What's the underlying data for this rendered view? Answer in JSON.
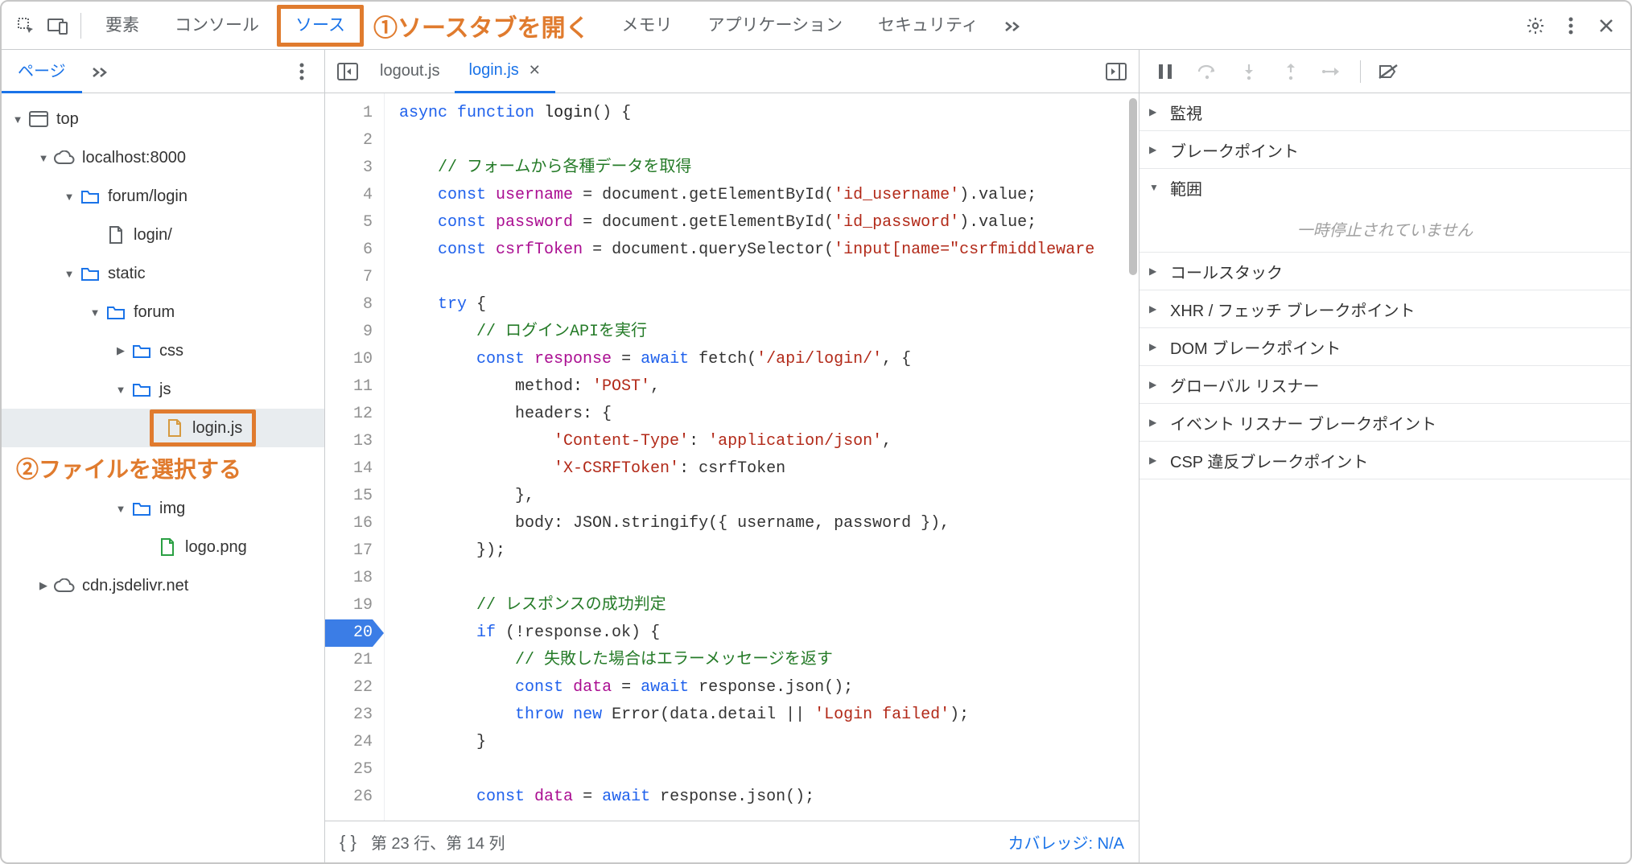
{
  "toolbar": {
    "tabs": {
      "elements": "要素",
      "console": "コンソール",
      "sources": "ソース",
      "memory": "メモリ",
      "application": "アプリケーション",
      "security": "セキュリティ"
    },
    "annotation1": "①ソースタブを開く"
  },
  "leftPanel": {
    "subTab": "ページ",
    "tree": {
      "top": "top",
      "host": "localhost:8000",
      "forumLogin": "forum/login",
      "loginPath": "login/",
      "static": "static",
      "forum": "forum",
      "css": "css",
      "js": "js",
      "loginJs": "login.js",
      "img": "img",
      "logoPng": "logo.png",
      "cdn": "cdn.jsdelivr.net"
    },
    "annotation2": "②ファイルを選択する"
  },
  "centerPanel": {
    "tabs": {
      "logout": "logout.js",
      "login": "login.js"
    },
    "status": {
      "cursor": "第 23 行、第 14 列",
      "coverage": "カバレッジ: N/A"
    },
    "code": {
      "l1": {
        "a": "async",
        "b": "function",
        "c": "login",
        "d": "() {"
      },
      "l3": "// フォームから各種データを取得",
      "l4": {
        "a": "const",
        "b": "username",
        "c": " = document.getElementById(",
        "d": "'id_username'",
        "e": ").value;"
      },
      "l5": {
        "a": "const",
        "b": "password",
        "c": " = document.getElementById(",
        "d": "'id_password'",
        "e": ").value;"
      },
      "l6": {
        "a": "const",
        "b": "csrfToken",
        "c": " = document.querySelector(",
        "d": "'input[name=\"csrfmiddleware",
        "e": ""
      },
      "l8": {
        "a": "try",
        "b": " {"
      },
      "l9": "// ログインAPIを実行",
      "l10": {
        "a": "const",
        "b": "response",
        "c": " = ",
        "d": "await",
        "e": " fetch(",
        "f": "'/api/login/'",
        "g": ", {"
      },
      "l11": {
        "a": "method: ",
        "b": "'POST'",
        "c": ","
      },
      "l12": "headers: {",
      "l13": {
        "a": "'Content-Type'",
        "b": ": ",
        "c": "'application/json'",
        "d": ","
      },
      "l14": {
        "a": "'X-CSRFToken'",
        "b": ": csrfToken"
      },
      "l15": "},",
      "l16": "body: JSON.stringify({ username, password }),",
      "l17": "});",
      "l19": "// レスポンスの成功判定",
      "l20": {
        "a": "if",
        "b": " (!response.ok) {"
      },
      "l21": "// 失敗した場合はエラーメッセージを返す",
      "l22": {
        "a": "const",
        "b": "data",
        "c": " = ",
        "d": "await",
        "e": " response.json();"
      },
      "l23": {
        "a": "throw",
        "b": "new",
        "c": " Error(data.detail || ",
        "d": "'Login failed'",
        "e": ");"
      },
      "l24": "}",
      "l26": {
        "a": "const",
        "b": "data",
        "c": " = ",
        "d": "await",
        "e": " response.json();"
      }
    }
  },
  "rightPanel": {
    "sections": {
      "watch": "監視",
      "breakpoints": "ブレークポイント",
      "scope": "範囲",
      "scopeBody": "一時停止されていません",
      "callStack": "コールスタック",
      "xhr": "XHR / フェッチ ブレークポイント",
      "dom": "DOM ブレークポイント",
      "global": "グローバル リスナー",
      "event": "イベント リスナー ブレークポイント",
      "csp": "CSP 違反ブレークポイント"
    }
  }
}
